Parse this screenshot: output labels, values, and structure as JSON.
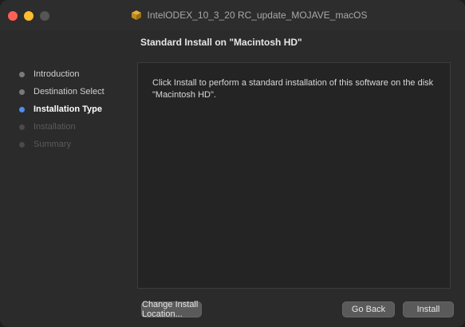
{
  "window": {
    "title": "IntelODEX_10_3_20 RC_update_MOJAVE_macOS"
  },
  "heading": "Standard Install on \"Macintosh HD\"",
  "sidebar": {
    "steps": [
      {
        "label": "Introduction",
        "state": "done"
      },
      {
        "label": "Destination Select",
        "state": "done"
      },
      {
        "label": "Installation Type",
        "state": "current"
      },
      {
        "label": "Installation",
        "state": "future"
      },
      {
        "label": "Summary",
        "state": "future"
      }
    ]
  },
  "content": {
    "text": "Click Install to perform a standard installation of this software on the disk \"Macintosh HD\"."
  },
  "buttons": {
    "change_location": "Change Install Location...",
    "go_back": "Go Back",
    "install": "Install"
  },
  "colors": {
    "current_step_dot": "#4d8ef0",
    "window_bg": "#2b2b2b"
  },
  "icons": {
    "title_icon": "package-icon"
  }
}
